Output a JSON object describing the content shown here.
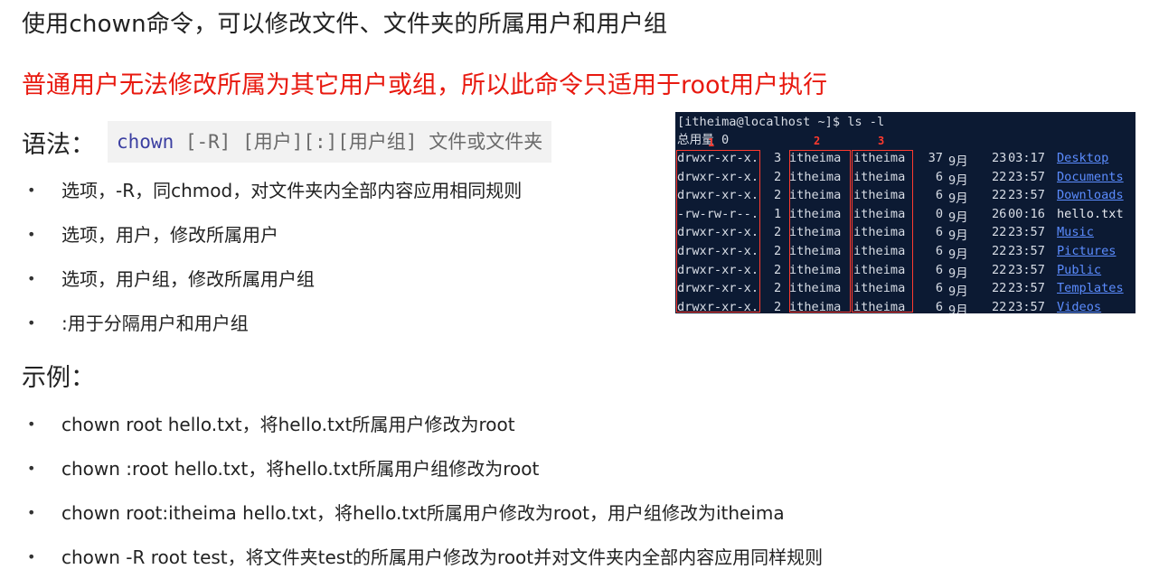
{
  "title": "使用chown命令，可以修改文件、文件夹的所属用户和用户组",
  "warning": "普通用户无法修改所属为其它用户或组，所以此命令只适用于root用户执行",
  "syntax": {
    "label": "语法：",
    "cmd": "chown",
    "args": " [-R] [用户][:][用户组] 文件或文件夹"
  },
  "options": [
    "选项，-R，同chmod，对文件夹内全部内容应用相同规则",
    "选项，用户，修改所属用户",
    "选项，用户组，修改所属用户组",
    ":用于分隔用户和用户组"
  ],
  "example_heading": "示例：",
  "examples": [
    "chown root hello.txt，将hello.txt所属用户修改为root",
    "chown :root hello.txt，将hello.txt所属用户组修改为root",
    "chown root:itheima hello.txt，将hello.txt所属用户修改为root，用户组修改为itheima",
    "chown -R root test，将文件夹test的所属用户修改为root并对文件夹内全部内容应用同样规则"
  ],
  "bullet": "•",
  "terminal": {
    "prompt": "[itheima@localhost ~]$ ls -l",
    "total": "总用量 0",
    "markers": [
      "1",
      "2",
      "3"
    ],
    "rows": [
      {
        "perm": "drwxr-xr-x.",
        "links": "3",
        "user": "itheima",
        "group": "itheima",
        "size": "37",
        "month": "9月",
        "day": "23",
        "time": "03:17",
        "name": "Desktop",
        "is_dir": true
      },
      {
        "perm": "drwxr-xr-x.",
        "links": "2",
        "user": "itheima",
        "group": "itheima",
        "size": "6",
        "month": "9月",
        "day": "22",
        "time": "23:57",
        "name": "Documents",
        "is_dir": true
      },
      {
        "perm": "drwxr-xr-x.",
        "links": "2",
        "user": "itheima",
        "group": "itheima",
        "size": "6",
        "month": "9月",
        "day": "22",
        "time": "23:57",
        "name": "Downloads",
        "is_dir": true
      },
      {
        "perm": "-rw-rw-r--.",
        "links": "1",
        "user": "itheima",
        "group": "itheima",
        "size": "0",
        "month": "9月",
        "day": "26",
        "time": "00:16",
        "name": "hello.txt",
        "is_dir": false
      },
      {
        "perm": "drwxr-xr-x.",
        "links": "2",
        "user": "itheima",
        "group": "itheima",
        "size": "6",
        "month": "9月",
        "day": "22",
        "time": "23:57",
        "name": "Music",
        "is_dir": true
      },
      {
        "perm": "drwxr-xr-x.",
        "links": "2",
        "user": "itheima",
        "group": "itheima",
        "size": "6",
        "month": "9月",
        "day": "22",
        "time": "23:57",
        "name": "Pictures",
        "is_dir": true
      },
      {
        "perm": "drwxr-xr-x.",
        "links": "2",
        "user": "itheima",
        "group": "itheima",
        "size": "6",
        "month": "9月",
        "day": "22",
        "time": "23:57",
        "name": "Public",
        "is_dir": true
      },
      {
        "perm": "drwxr-xr-x.",
        "links": "2",
        "user": "itheima",
        "group": "itheima",
        "size": "6",
        "month": "9月",
        "day": "22",
        "time": "23:57",
        "name": "Templates",
        "is_dir": true
      },
      {
        "perm": "drwxr-xr-x.",
        "links": "2",
        "user": "itheima",
        "group": "itheima",
        "size": "6",
        "month": "9月",
        "day": "22",
        "time": "23:57",
        "name": "Videos",
        "is_dir": true
      }
    ]
  },
  "colors": {
    "warning": "#e8190f",
    "syntax_cmd": "#3b3fa1",
    "terminal_bg": "#0c1a33",
    "highlight_box": "#ff3a2e",
    "dir_link": "#5b8cff"
  }
}
